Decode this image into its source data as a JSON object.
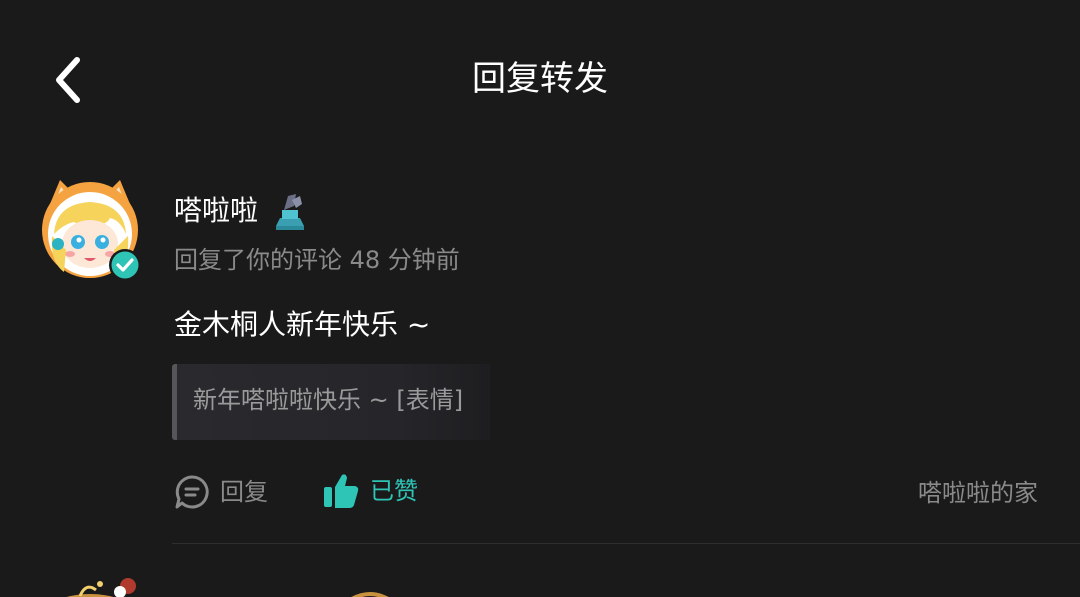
{
  "header": {
    "title": "回复转发",
    "back_icon": "chevron-left-icon"
  },
  "comment": {
    "username": "嗒啦啦",
    "avatar_icon": "anime-avatar-shiba-hat",
    "verified_icon": "verified-check-icon",
    "badge_icon": "fan-badge-icon",
    "meta": "回复了你的评论 48 分钟前",
    "content": "金木桐人新年快乐 ~",
    "quoted_text": "新年嗒啦啦快乐 ~ [表情]",
    "actions": {
      "reply_label": "回复",
      "reply_icon": "comment-bubble-icon",
      "like_label": "已赞",
      "like_icon": "thumbs-up-icon",
      "home_link": "嗒啦啦的家"
    }
  },
  "colors": {
    "background": "#1a1a1a",
    "accent": "#2ec4b6",
    "secondary_text": "#8a8a8a"
  }
}
